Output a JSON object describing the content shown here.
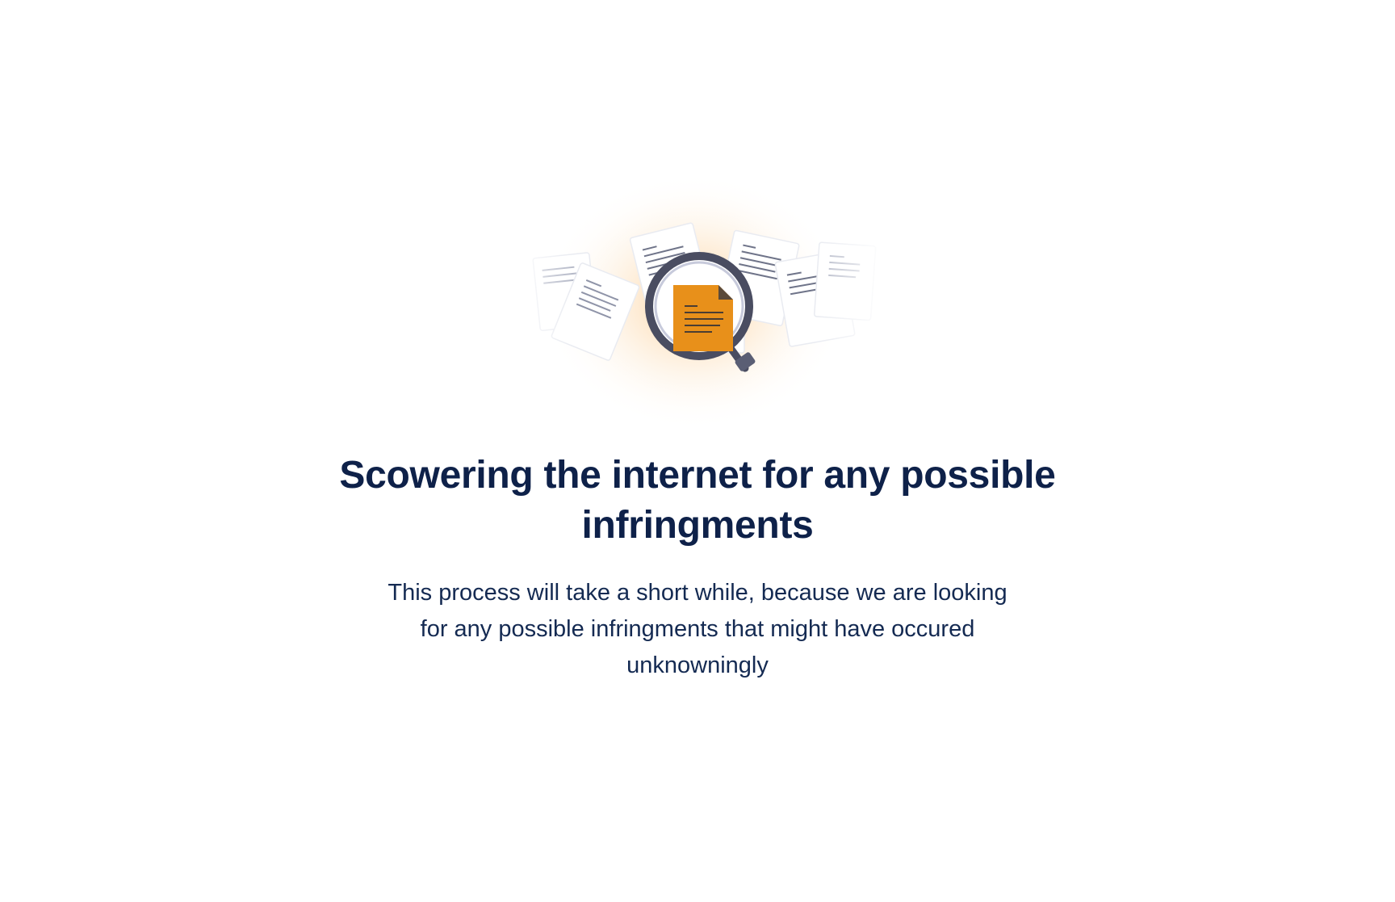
{
  "illustration": {
    "icon": "magnifying-glass-document-icon",
    "accent_color": "#e8901a",
    "glass_color": "#4a4d61"
  },
  "content": {
    "title": "Scowering the internet for any possible infringments",
    "description": "This process will take a short while, because we are looking for any possible infringments that might have occured unknowningly"
  },
  "colors": {
    "heading": "#0e2149",
    "body_text": "#142a52",
    "background": "#ffffff"
  }
}
